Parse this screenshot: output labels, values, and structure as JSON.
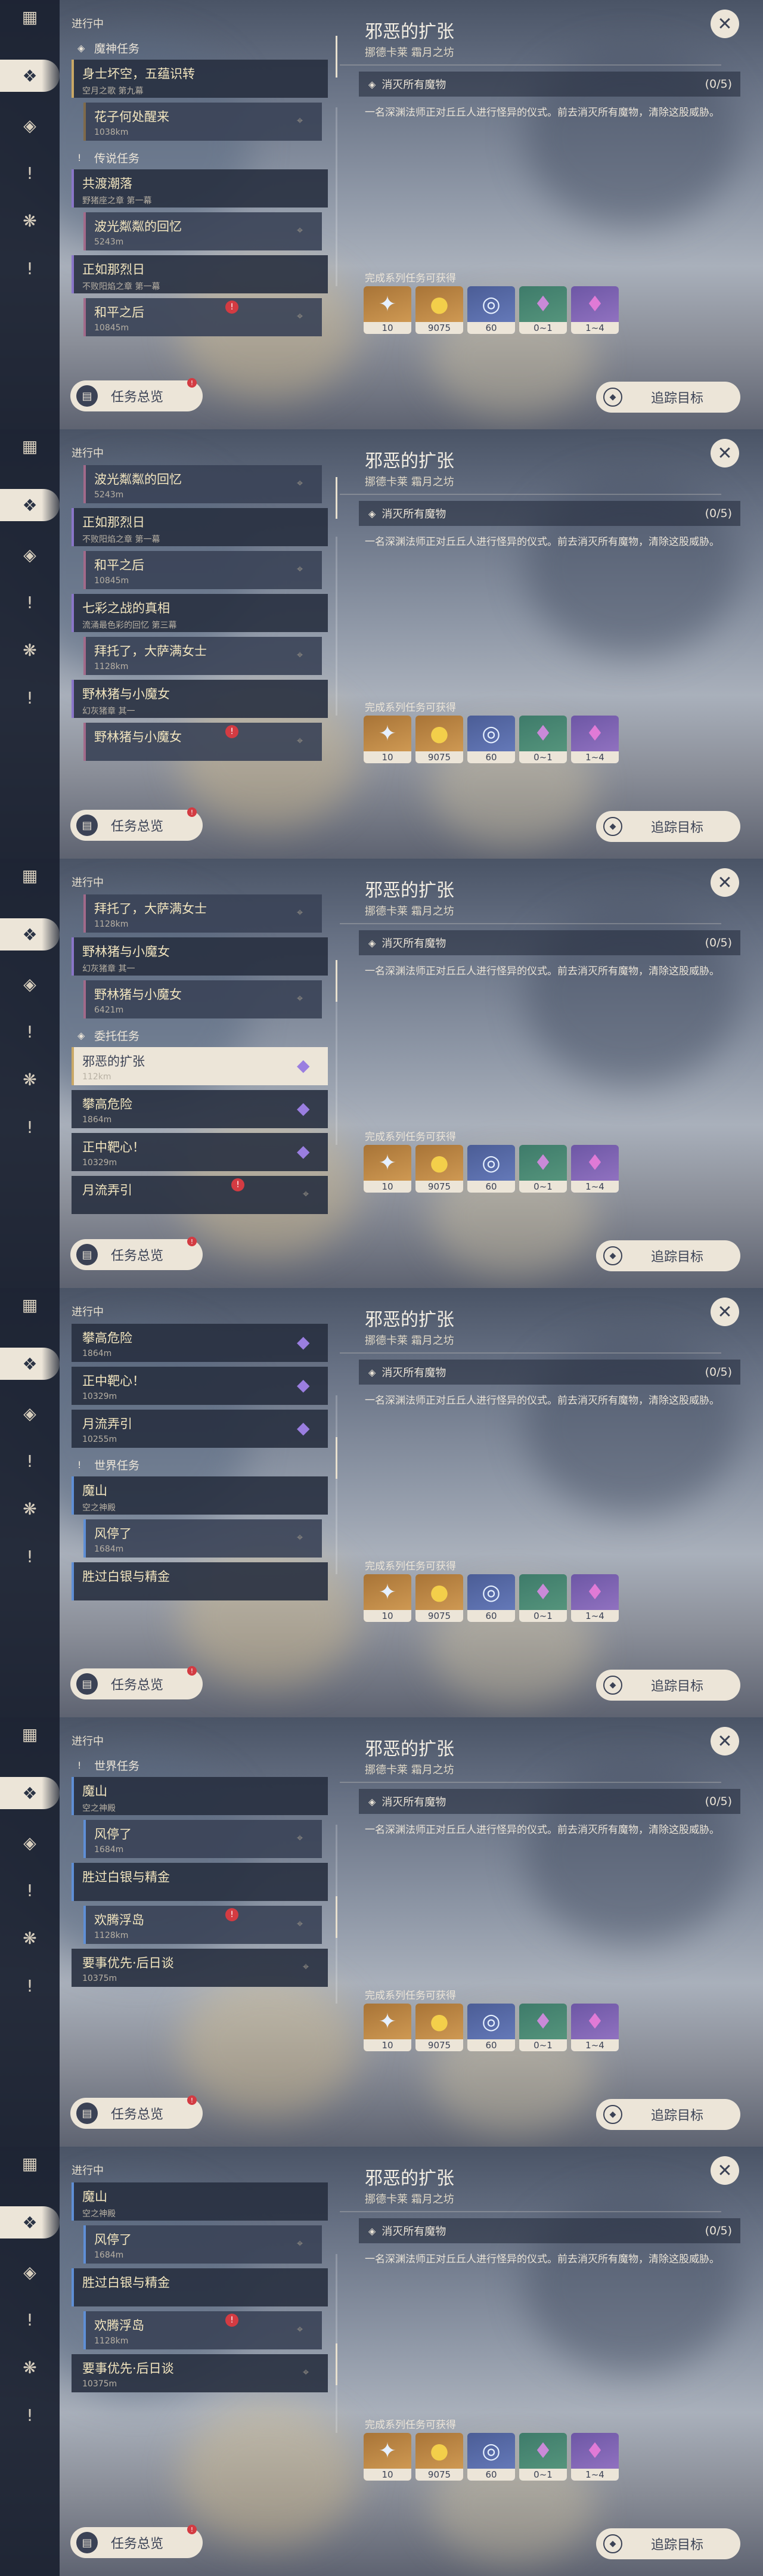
{
  "labels": {
    "in_progress": "进行中",
    "overview": "任务总览",
    "track": "追踪目标",
    "rewards_title": "完成系列任务可获得"
  },
  "detail": {
    "title": "邪恶的扩张",
    "location": "挪德卡莱 霜月之坊",
    "objective": "消灭所有魔物",
    "objective_count": "(0/5)",
    "description": "一名深渊法师正对丘丘人进行怪异的仪式。前去消灭所有魔物，清除这股威胁。"
  },
  "rewards": [
    {
      "icon": "star-icon",
      "count": "10",
      "style": "gold"
    },
    {
      "icon": "mora-icon",
      "count": "9075",
      "style": "gold"
    },
    {
      "icon": "experience-icon",
      "count": "60",
      "style": "blue"
    },
    {
      "icon": "crystal-green-icon",
      "count": "0~1",
      "style": "green"
    },
    {
      "icon": "crystal-purple-icon",
      "count": "1~4",
      "style": "purple"
    }
  ],
  "frames": [
    {
      "items": [
        {
          "kind": "cat",
          "label": "魔神任务",
          "icon": "archon"
        },
        {
          "kind": "q",
          "cls": "",
          "title": "身士坏空，五蕴识转",
          "sub": "空月之歌 第九幕"
        },
        {
          "kind": "q",
          "cls": "sub",
          "title": "花子何处醒来",
          "sub": "1038km"
        },
        {
          "kind": "cat",
          "label": "传说任务",
          "icon": "legend"
        },
        {
          "kind": "q",
          "cls": "legend",
          "title": "共渡潮落",
          "sub": "野猪座之章 第一幕"
        },
        {
          "kind": "q",
          "cls": "sub legend",
          "title": "波光粼粼的回忆",
          "sub": "5243m"
        },
        {
          "kind": "q",
          "cls": "legend",
          "title": "正如那烈日",
          "sub": "不败阳焰之章 第一幕"
        },
        {
          "kind": "q",
          "cls": "sub legend",
          "title": "和平之后",
          "sub": "10845m",
          "alert": true
        }
      ]
    },
    {
      "items": [
        {
          "kind": "q",
          "cls": "sub legend",
          "title": "波光粼粼的回忆",
          "sub": "5243m"
        },
        {
          "kind": "q",
          "cls": "legend",
          "title": "正如那烈日",
          "sub": "不败阳焰之章 第一幕"
        },
        {
          "kind": "q",
          "cls": "sub legend",
          "title": "和平之后",
          "sub": "10845m"
        },
        {
          "kind": "q",
          "cls": "legend",
          "title": "七彩之战的真相",
          "sub": "流涌最色彩的回忆 第三幕"
        },
        {
          "kind": "q",
          "cls": "sub legend",
          "title": "拜托了，大萨满女士",
          "sub": "1128km"
        },
        {
          "kind": "q",
          "cls": "legend",
          "title": "野林猪与小魔女",
          "sub": "幻灰猪章 其一"
        },
        {
          "kind": "q",
          "cls": "sub legend",
          "title": "野林猪与小魔女",
          "sub": "",
          "alert": true
        }
      ]
    },
    {
      "items": [
        {
          "kind": "q",
          "cls": "sub legend",
          "title": "拜托了，大萨满女士",
          "sub": "1128km"
        },
        {
          "kind": "q",
          "cls": "legend",
          "title": "野林猪与小魔女",
          "sub": "幻灰猪章 其一"
        },
        {
          "kind": "q",
          "cls": "sub legend",
          "title": "野林猪与小魔女",
          "sub": "6421m"
        },
        {
          "kind": "cat",
          "label": "委托任务",
          "icon": "commission"
        },
        {
          "kind": "q",
          "cls": "selected",
          "title": "邪恶的扩张",
          "sub": "112km",
          "diamond": true
        },
        {
          "kind": "q",
          "cls": "plain",
          "title": "攀高危险",
          "sub": "1864m",
          "diamond": true
        },
        {
          "kind": "q",
          "cls": "plain",
          "title": "正中靶心！",
          "sub": "10329m",
          "diamond": true
        },
        {
          "kind": "q",
          "cls": "plain",
          "title": "月流弄引",
          "sub": "",
          "alert": true
        }
      ]
    },
    {
      "items": [
        {
          "kind": "q",
          "cls": "plain",
          "title": "攀高危险",
          "sub": "1864m",
          "diamond": true
        },
        {
          "kind": "q",
          "cls": "plain",
          "title": "正中靶心！",
          "sub": "10329m",
          "diamond": true
        },
        {
          "kind": "q",
          "cls": "plain",
          "title": "月流弄引",
          "sub": "10255m",
          "diamond": true
        },
        {
          "kind": "cat",
          "label": "世界任务",
          "icon": "world"
        },
        {
          "kind": "q",
          "cls": "world",
          "title": "魔山",
          "sub": "空之神殿"
        },
        {
          "kind": "q",
          "cls": "sub world",
          "title": "风停了",
          "sub": "1684m"
        },
        {
          "kind": "q",
          "cls": "world",
          "title": "胜过白银与精金",
          "sub": ""
        }
      ]
    },
    {
      "items": [
        {
          "kind": "cat",
          "label": "世界任务",
          "icon": "world"
        },
        {
          "kind": "q",
          "cls": "world",
          "title": "魔山",
          "sub": "空之神殿"
        },
        {
          "kind": "q",
          "cls": "sub world",
          "title": "风停了",
          "sub": "1684m"
        },
        {
          "kind": "q",
          "cls": "world",
          "title": "胜过白银与精金",
          "sub": ""
        },
        {
          "kind": "q",
          "cls": "sub world",
          "title": "欢腾浮岛",
          "sub": "1128km",
          "alert": true
        },
        {
          "kind": "q",
          "cls": "plain",
          "title": "要事优先·后日谈",
          "sub": "10375m"
        }
      ]
    },
    {
      "items": [
        {
          "kind": "q",
          "cls": "world",
          "title": "魔山",
          "sub": "空之神殿"
        },
        {
          "kind": "q",
          "cls": "sub world",
          "title": "风停了",
          "sub": "1684m"
        },
        {
          "kind": "q",
          "cls": "world",
          "title": "胜过白银与精金",
          "sub": ""
        },
        {
          "kind": "q",
          "cls": "sub world",
          "title": "欢腾浮岛",
          "sub": "1128km",
          "alert": true
        },
        {
          "kind": "q",
          "cls": "plain",
          "title": "要事优先·后日谈",
          "sub": "10375m"
        }
      ]
    }
  ]
}
